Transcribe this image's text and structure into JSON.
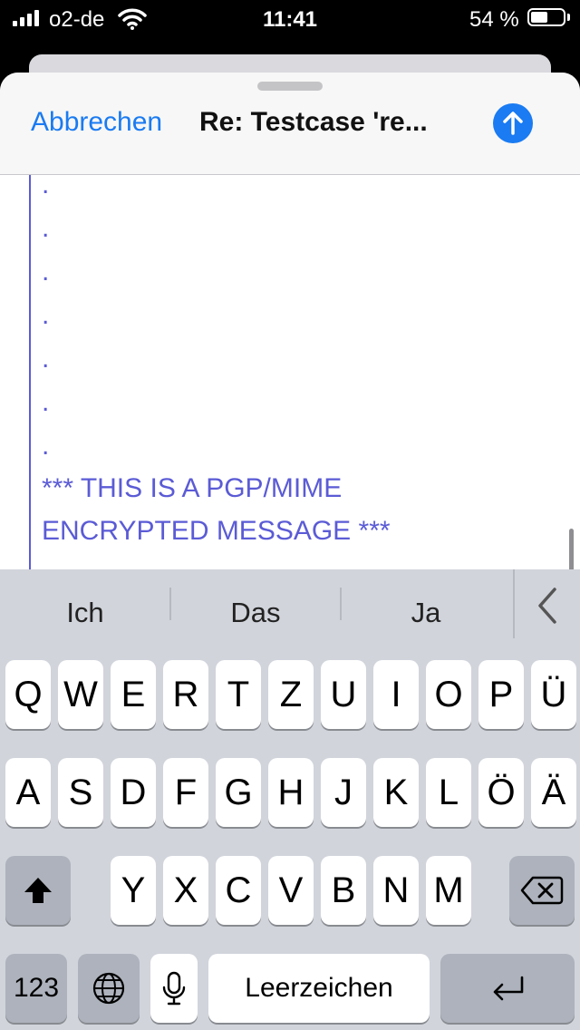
{
  "status": {
    "carrier": "o2-de",
    "time": "11:41",
    "battery_pct": "54 %",
    "battery_level": 0.54
  },
  "compose": {
    "cancel_label": "Abbrechen",
    "subject": "Re: Testcase 're...",
    "send_icon": "arrow-up-circle-icon"
  },
  "body": {
    "dots": [
      ".",
      ".",
      ".",
      ".",
      ".",
      ".",
      "."
    ],
    "pgp_line1": "*** THIS IS A PGP/MIME",
    "pgp_line2": "ENCRYPTED MESSAGE ***",
    "quote_color": "#5b5bd6"
  },
  "keyboard": {
    "suggestions": [
      "Ich",
      "Das",
      "Ja"
    ],
    "row1": [
      "Q",
      "W",
      "E",
      "R",
      "T",
      "Z",
      "U",
      "I",
      "O",
      "P",
      "Ü"
    ],
    "row2": [
      "A",
      "S",
      "D",
      "F",
      "G",
      "H",
      "J",
      "K",
      "L",
      "Ö",
      "Ä"
    ],
    "row3": [
      "Y",
      "X",
      "C",
      "V",
      "B",
      "N",
      "M"
    ],
    "numbers_label": "123",
    "space_label": "Leerzeichen"
  },
  "colors": {
    "accent": "#1a7bf2",
    "keyboard_bg": "#d1d4db"
  }
}
